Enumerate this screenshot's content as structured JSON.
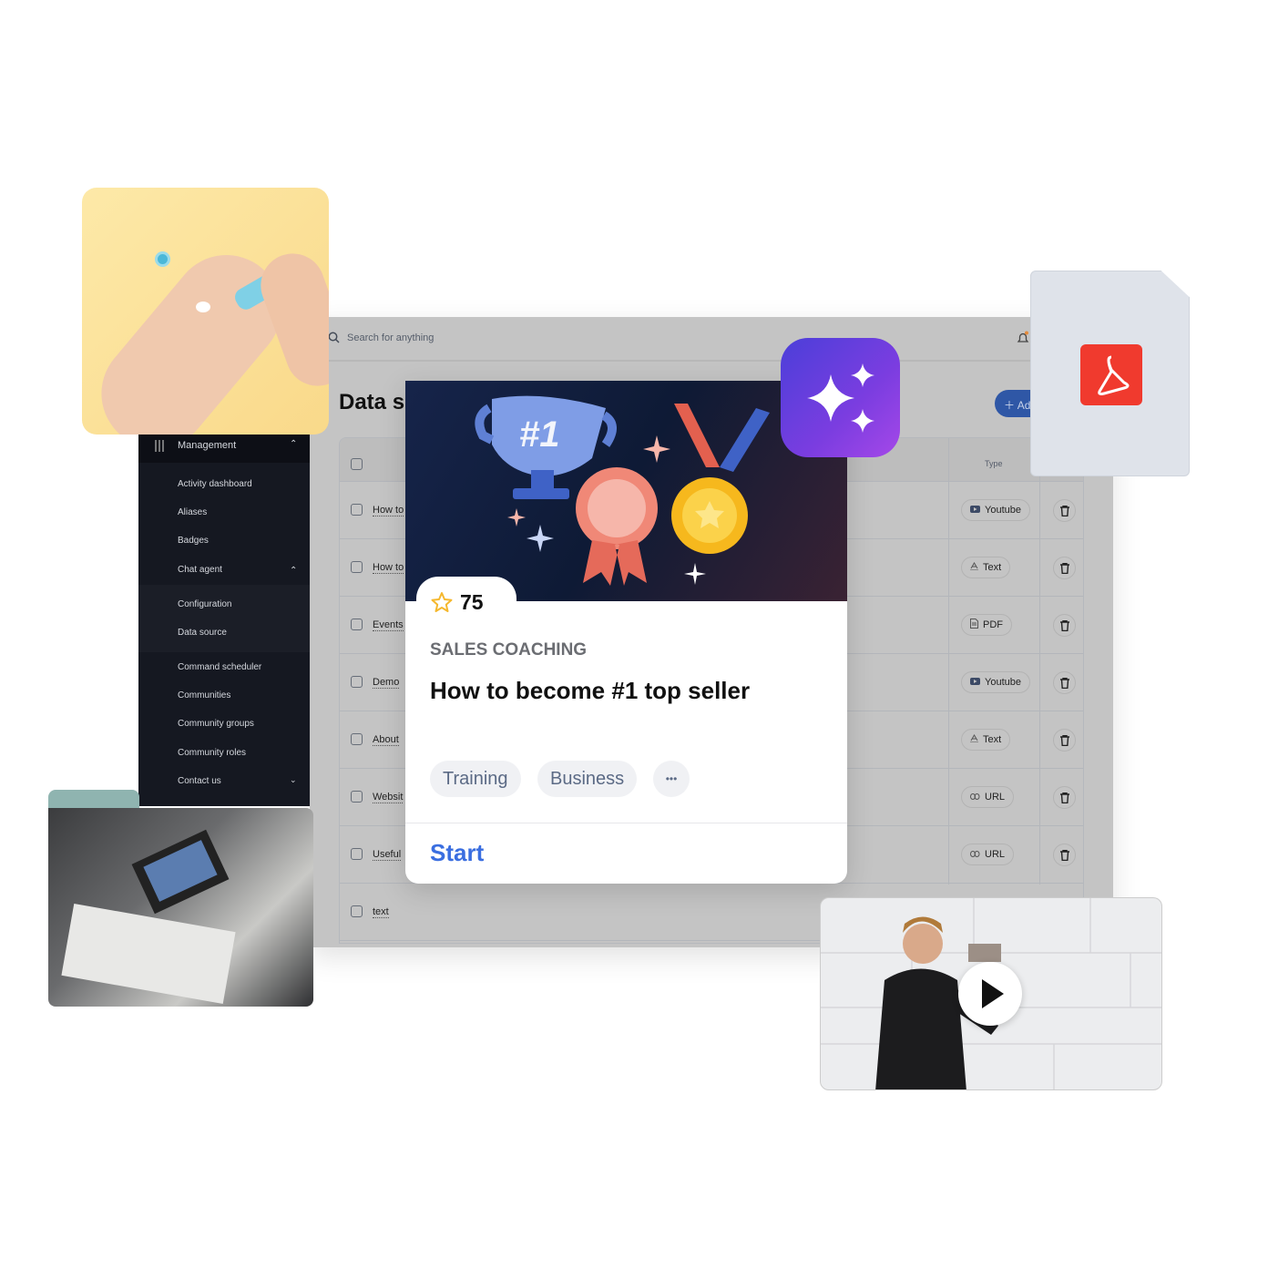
{
  "topbar": {
    "search_placeholder": "Search for anything"
  },
  "page": {
    "title": "Data s",
    "add_button": "Ad"
  },
  "sidebar": {
    "section": "Management",
    "items": [
      {
        "label": "Activity dashboard"
      },
      {
        "label": "Aliases"
      },
      {
        "label": "Badges"
      },
      {
        "label": "Chat agent"
      },
      {
        "label": "Configuration"
      },
      {
        "label": "Data source"
      },
      {
        "label": "Command scheduler"
      },
      {
        "label": "Communities"
      },
      {
        "label": "Community groups"
      },
      {
        "label": "Community roles"
      },
      {
        "label": "Contact us"
      }
    ]
  },
  "table": {
    "type_header": "Type",
    "rows": [
      {
        "title": "How to",
        "type": "Youtube",
        "icon": "youtube-icon"
      },
      {
        "title": "How to",
        "type": "Text",
        "icon": "text-icon"
      },
      {
        "title": "Events",
        "type": "PDF",
        "icon": "document-icon"
      },
      {
        "title": "Demo",
        "type": "Youtube",
        "icon": "youtube-icon"
      },
      {
        "title": "About",
        "type": "Text",
        "icon": "text-icon"
      },
      {
        "title": "Websit",
        "type": "URL",
        "icon": "link-icon"
      },
      {
        "title": "Useful",
        "type": "URL",
        "icon": "link-icon"
      },
      {
        "title": "text",
        "type": "",
        "icon": ""
      }
    ]
  },
  "card": {
    "rating": "75",
    "category": "SALES COACHING",
    "title": "How to become #1 top seller",
    "tags": [
      "Training",
      "Business"
    ],
    "more_label": "•••",
    "action": "Start",
    "trophy_label": "#1"
  },
  "colors": {
    "accent": "#3a6ee0",
    "star": "#f5b82e",
    "pdf_red": "#f03a2e",
    "sidebar": "#151821"
  }
}
